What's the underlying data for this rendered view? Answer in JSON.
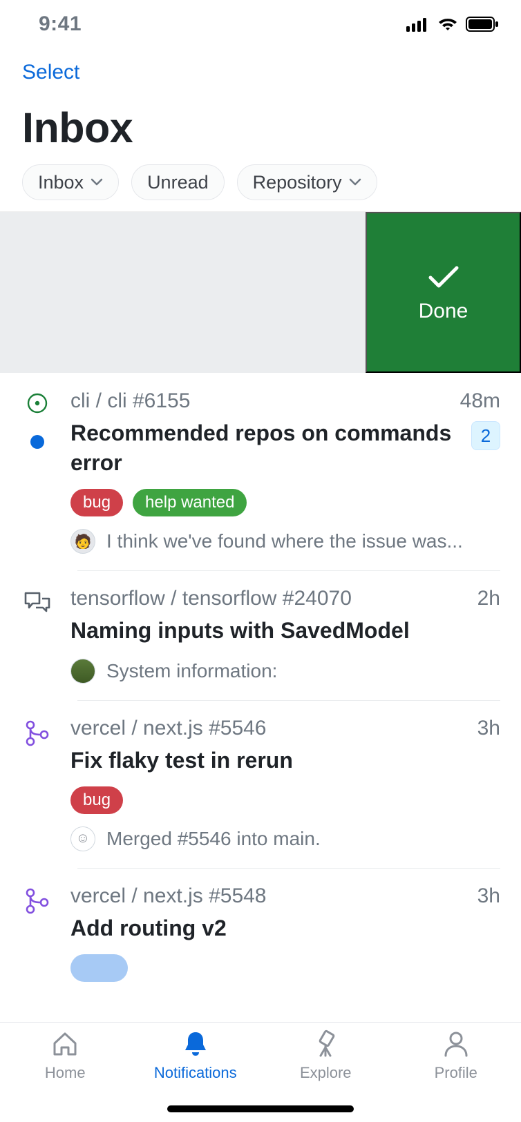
{
  "statusbar": {
    "time": "9:41"
  },
  "header": {
    "select_label": "Select",
    "title": "Inbox",
    "filters": {
      "inbox": "Inbox",
      "unread": "Unread",
      "repository": "Repository"
    }
  },
  "swipe_action": {
    "label": "Done"
  },
  "items": [
    {
      "repo": "cli / cli #6155",
      "time": "48m",
      "title": "Recommended repos on commands error",
      "count": "2",
      "labels": [
        {
          "text": "bug",
          "kind": "bug"
        },
        {
          "text": "help wanted",
          "kind": "help"
        }
      ],
      "comment": "I think we've found where the issue was..."
    },
    {
      "repo": "tensorflow / tensorflow #24070",
      "time": "2h",
      "title": "Naming inputs with SavedModel",
      "comment": "System information:"
    },
    {
      "repo": "vercel / next.js #5546",
      "time": "3h",
      "title": "Fix flaky test in rerun",
      "labels": [
        {
          "text": "bug",
          "kind": "bug"
        }
      ],
      "comment": "Merged #5546 into main."
    },
    {
      "repo": "vercel / next.js #5548",
      "time": "3h",
      "title": "Add routing v2"
    }
  ],
  "tabbar": {
    "home": "Home",
    "notifications": "Notifications",
    "explore": "Explore",
    "profile": "Profile"
  }
}
